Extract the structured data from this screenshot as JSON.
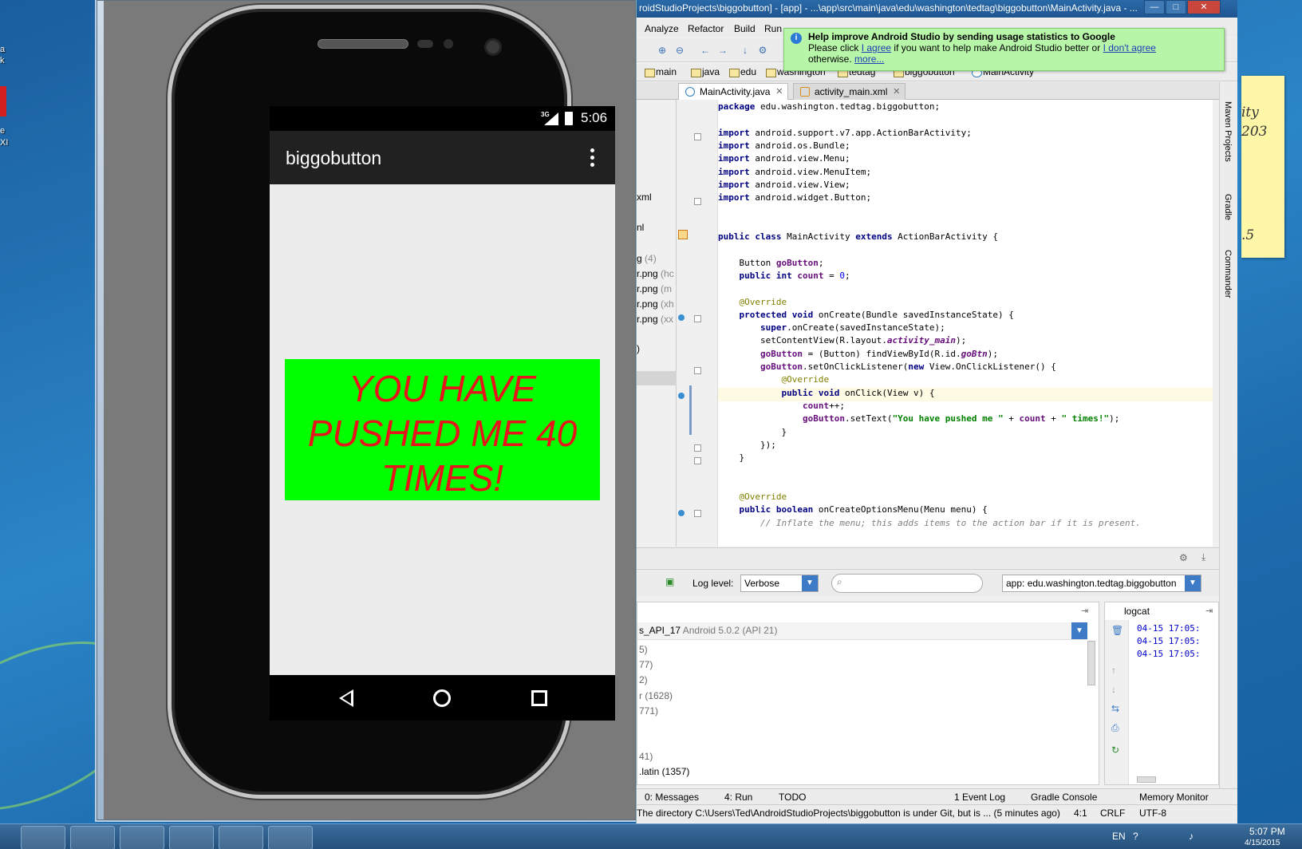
{
  "emulator": {
    "status_network": "3G",
    "status_time": "5:06",
    "app_title": "biggobutton",
    "button_text": "YOU HAVE PUSHED ME 40 TIMES!"
  },
  "ide": {
    "window_title": "roidStudioProjects\\biggobutton] - [app] - ...\\app\\src\\main\\java\\edu\\washington\\tedtag\\biggobutton\\MainActivity.java - ...",
    "window_controls": {
      "minimize": "—",
      "maximize": "□",
      "close": "✕"
    },
    "menu": [
      "Analyze",
      "Refactor",
      "Build",
      "Run"
    ],
    "breadcrumbs": [
      "main",
      "java",
      "edu",
      "washington",
      "tedtag",
      "biggobutton",
      "MainActivity"
    ],
    "tabs": [
      {
        "label": "MainActivity.java",
        "active": true
      },
      {
        "label": "activity_main.xml",
        "active": false
      }
    ],
    "notification": {
      "title": "Help improve Android Studio by sending usage statistics to Google",
      "line1_prefix": "Please click",
      "agree": "I agree",
      "line1_mid": "if you want to help make Android Studio better or",
      "disagree": "I don't agree",
      "line2_prefix": "otherwise.",
      "more": "more..."
    },
    "project_fragments": [
      {
        "text": "xml",
        "note": ""
      },
      {
        "text": "nl",
        "note": ""
      },
      {
        "text": "g",
        "note": "(4)"
      },
      {
        "text": "r.png",
        "note": "(hc"
      },
      {
        "text": "r.png",
        "note": "(m"
      },
      {
        "text": "r.png",
        "note": "(xh"
      },
      {
        "text": "r.png",
        "note": "(xx"
      },
      {
        "text": ")",
        "note": ""
      }
    ],
    "right_tools": [
      "Maven Projects",
      "Gradle",
      "Commander"
    ],
    "logcat": {
      "log_level_label": "Log level:",
      "log_level": "Verbose",
      "search_placeholder": "",
      "app_filter": "app: edu.washington.tedtag.biggobutton",
      "device": "s_API_17",
      "device_detail": "Android 5.0.2 (API 21)",
      "process_lines": [
        "5)",
        "77)",
        "2)",
        "r (1628)",
        "771)",
        "41)",
        ".latin (1357)"
      ],
      "panel_title": "logcat",
      "log_lines": [
        "04-15 17:05:",
        "04-15 17:05:",
        "04-15 17:05:"
      ]
    },
    "bottom_tabs": [
      "0: Messages",
      "4: Run",
      "TODO",
      "1 Event Log",
      "Gradle Console",
      "Memory Monitor"
    ],
    "status_message": "The directory C:\\Users\\Ted\\AndroidStudioProjects\\biggobutton is under Git, but is ... (5 minutes ago)",
    "cursor_pos": "4:1",
    "line_sep": "CRLF",
    "encoding": "UTF-8"
  },
  "code": [
    {
      "t": [
        {
          "c": "kw",
          "s": "package"
        },
        {
          "c": "",
          "s": " edu.washington.tedtag.biggobutton;"
        }
      ]
    },
    {
      "t": []
    },
    {
      "t": [
        {
          "c": "kw",
          "s": "import"
        },
        {
          "c": "",
          "s": " android.support.v7.app.ActionBarActivity;"
        }
      ]
    },
    {
      "t": [
        {
          "c": "kw",
          "s": "import"
        },
        {
          "c": "",
          "s": " android.os.Bundle;"
        }
      ]
    },
    {
      "t": [
        {
          "c": "kw",
          "s": "import"
        },
        {
          "c": "",
          "s": " android.view.Menu;"
        }
      ]
    },
    {
      "t": [
        {
          "c": "kw",
          "s": "import"
        },
        {
          "c": "",
          "s": " android.view.MenuItem;"
        }
      ]
    },
    {
      "t": [
        {
          "c": "kw",
          "s": "import"
        },
        {
          "c": "",
          "s": " android.view.View;"
        }
      ]
    },
    {
      "t": [
        {
          "c": "kw",
          "s": "import"
        },
        {
          "c": "",
          "s": " android.widget.Button;"
        }
      ]
    },
    {
      "t": []
    },
    {
      "t": []
    },
    {
      "t": [
        {
          "c": "kw",
          "s": "public class"
        },
        {
          "c": "",
          "s": " MainActivity "
        },
        {
          "c": "kw",
          "s": "extends"
        },
        {
          "c": "",
          "s": " ActionBarActivity {"
        }
      ]
    },
    {
      "t": []
    },
    {
      "t": [
        {
          "c": "",
          "s": "    Button "
        },
        {
          "c": "fld",
          "s": "goButton"
        },
        {
          "c": "",
          "s": ";"
        }
      ]
    },
    {
      "t": [
        {
          "c": "",
          "s": "    "
        },
        {
          "c": "kw",
          "s": "public int"
        },
        {
          "c": "",
          "s": " "
        },
        {
          "c": "fld",
          "s": "count"
        },
        {
          "c": "",
          "s": " = "
        },
        {
          "c": "num",
          "s": "0"
        },
        {
          "c": "",
          "s": ";"
        }
      ]
    },
    {
      "t": []
    },
    {
      "t": [
        {
          "c": "",
          "s": "    "
        },
        {
          "c": "an",
          "s": "@Override"
        }
      ]
    },
    {
      "t": [
        {
          "c": "",
          "s": "    "
        },
        {
          "c": "kw",
          "s": "protected void"
        },
        {
          "c": "",
          "s": " onCreate(Bundle savedInstanceState) {"
        }
      ]
    },
    {
      "t": [
        {
          "c": "",
          "s": "        "
        },
        {
          "c": "kw",
          "s": "super"
        },
        {
          "c": "",
          "s": ".onCreate(savedInstanceState);"
        }
      ]
    },
    {
      "t": [
        {
          "c": "",
          "s": "        setContentView(R.layout."
        },
        {
          "c": "it",
          "s": "activity_main"
        },
        {
          "c": "",
          "s": ");"
        }
      ]
    },
    {
      "t": [
        {
          "c": "",
          "s": "        "
        },
        {
          "c": "fld",
          "s": "goButton"
        },
        {
          "c": "",
          "s": " = (Button) findViewById(R.id."
        },
        {
          "c": "it",
          "s": "goBtn"
        },
        {
          "c": "",
          "s": ");"
        }
      ]
    },
    {
      "t": [
        {
          "c": "",
          "s": "        "
        },
        {
          "c": "fld",
          "s": "goButton"
        },
        {
          "c": "",
          "s": ".setOnClickListener("
        },
        {
          "c": "kw",
          "s": "new"
        },
        {
          "c": "",
          "s": " View.OnClickListener() {"
        }
      ]
    },
    {
      "t": [
        {
          "c": "",
          "s": "            "
        },
        {
          "c": "an",
          "s": "@Override"
        }
      ]
    },
    {
      "t": [
        {
          "c": "",
          "s": "            "
        },
        {
          "c": "kw",
          "s": "public void"
        },
        {
          "c": "",
          "s": " onClick(View v) {"
        }
      ],
      "hl": true
    },
    {
      "t": [
        {
          "c": "",
          "s": "                "
        },
        {
          "c": "fld",
          "s": "count"
        },
        {
          "c": "",
          "s": "++;"
        }
      ]
    },
    {
      "t": [
        {
          "c": "",
          "s": "                "
        },
        {
          "c": "fld",
          "s": "goButton"
        },
        {
          "c": "",
          "s": ".setText("
        },
        {
          "c": "str",
          "s": "\"You have pushed me \""
        },
        {
          "c": "",
          "s": " + "
        },
        {
          "c": "fld",
          "s": "count"
        },
        {
          "c": "",
          "s": " + "
        },
        {
          "c": "str",
          "s": "\" times!\""
        },
        {
          "c": "",
          "s": ");"
        }
      ]
    },
    {
      "t": [
        {
          "c": "",
          "s": "            }"
        }
      ]
    },
    {
      "t": [
        {
          "c": "",
          "s": "        });"
        }
      ]
    },
    {
      "t": [
        {
          "c": "",
          "s": "    }"
        }
      ]
    },
    {
      "t": []
    },
    {
      "t": []
    },
    {
      "t": [
        {
          "c": "",
          "s": "    "
        },
        {
          "c": "an",
          "s": "@Override"
        }
      ]
    },
    {
      "t": [
        {
          "c": "",
          "s": "    "
        },
        {
          "c": "kw",
          "s": "public boolean"
        },
        {
          "c": "",
          "s": " onCreateOptionsMenu(Menu menu) {"
        }
      ]
    },
    {
      "t": [
        {
          "c": "",
          "s": "        "
        },
        {
          "c": "cmt",
          "s": "// Inflate the menu; this adds items to the action bar if it is present."
        }
      ]
    }
  ],
  "desktop": {
    "icon_labels": [
      "a",
      "k",
      "e",
      "XI"
    ],
    "sticky_lines": [
      "ity",
      "203",
      ".5"
    ]
  },
  "taskbar": {
    "language": "EN",
    "clock_time": "5:07 PM",
    "clock_date": "4/15/2015"
  }
}
